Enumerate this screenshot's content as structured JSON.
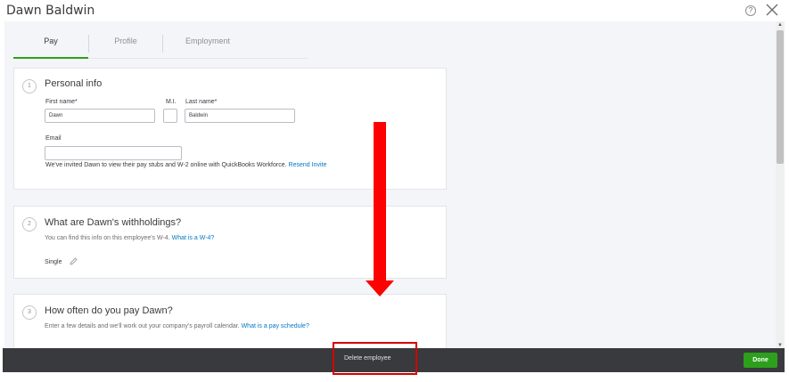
{
  "window": {
    "title": "Dawn Baldwin"
  },
  "header": {
    "help_glyph": "?"
  },
  "tabs": [
    {
      "label": "Pay",
      "active": true
    },
    {
      "label": "Profile",
      "active": false
    },
    {
      "label": "Employment",
      "active": false
    }
  ],
  "personal_info": {
    "step": "1",
    "title": "Personal info",
    "first_name_label": "First name*",
    "first_name_value": "Dawn",
    "mi_label": "M.I.",
    "mi_value": "",
    "last_name_label": "Last name*",
    "last_name_value": "Baldwin",
    "email_label": "Email",
    "email_value": "",
    "invite_text": "We've invited Dawn to view their pay stubs and W-2 online with QuickBooks Workforce.",
    "invite_link": "Resend Invite"
  },
  "withholdings": {
    "step": "2",
    "title": "What are Dawn's withholdings?",
    "hint": "You can find this info on this employee's W-4.",
    "hint_link": "What is a W-4?",
    "filing_status": "Single"
  },
  "pay_schedule": {
    "step": "3",
    "title": "How often do you pay Dawn?",
    "hint": "Enter a few details and we'll work out your company's payroll calendar.",
    "hint_link": "What is a pay schedule?"
  },
  "footer": {
    "delete_label": "Delete employee",
    "done_label": "Done"
  },
  "colors": {
    "accent_green": "#2ca01c",
    "link_blue": "#0077c5",
    "footer_bg": "#393a3d",
    "annotation_red": "#ff0000"
  },
  "icons": [
    "help-icon",
    "close-icon",
    "pencil-icon"
  ]
}
